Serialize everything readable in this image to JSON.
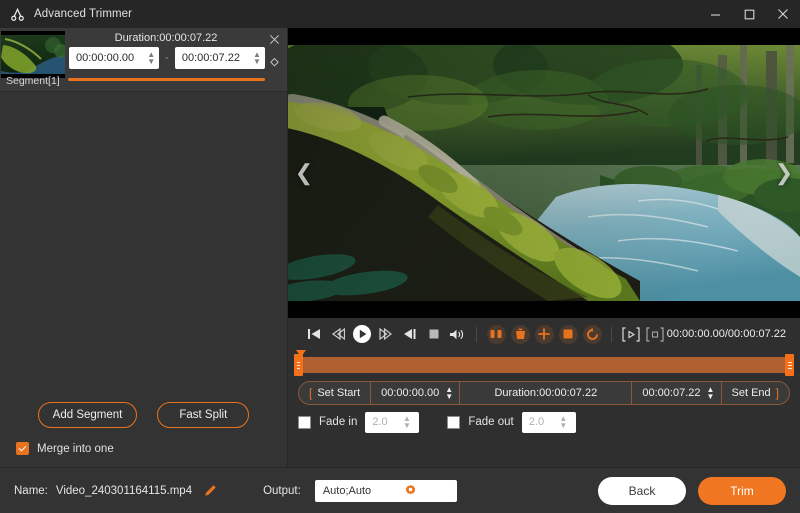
{
  "window": {
    "title": "Advanced Trimmer",
    "logo_icon": "scissors-icon",
    "minimize_icon": "minimize-icon",
    "maximize_icon": "maximize-icon",
    "close_icon": "close-icon"
  },
  "segments_panel": {
    "segments": [
      {
        "duration_label": "Duration:00:00:07.22",
        "start_time": "00:00:00.00",
        "end_time": "00:00:07.22",
        "name": "Segment[1]",
        "separator": "-",
        "close_icon": "close-icon",
        "collapse_icon": "expand-collapse-icon"
      }
    ],
    "add_segment_label": "Add Segment",
    "fast_split_label": "Fast Split",
    "merge_label": "Merge into one",
    "merge_checked": true
  },
  "preview": {
    "prev_icon": "chevron-left-icon",
    "next_icon": "chevron-right-icon",
    "scene_alt": "forest-stream-with-mossy-log"
  },
  "player": {
    "controls": [
      {
        "name": "jump-to-start-button",
        "icon": "skip-to-start-icon"
      },
      {
        "name": "step-backward-button",
        "icon": "rewind-icon"
      },
      {
        "name": "play-button",
        "icon": "play-icon"
      },
      {
        "name": "step-forward-button",
        "icon": "fast-forward-icon"
      },
      {
        "name": "jump-to-end-button",
        "icon": "skip-to-end-icon"
      },
      {
        "name": "stop-button",
        "icon": "stop-icon"
      },
      {
        "name": "volume-button",
        "icon": "volume-icon"
      }
    ],
    "edit_controls": [
      {
        "name": "split-button",
        "icon": "split-icon"
      },
      {
        "name": "delete-button",
        "icon": "trash-icon"
      },
      {
        "name": "add-button",
        "icon": "plus-icon"
      },
      {
        "name": "crop-button",
        "icon": "square-icon"
      },
      {
        "name": "reset-button",
        "icon": "undo-icon"
      }
    ],
    "frame_controls": [
      {
        "name": "set-playback-marker-button",
        "icon": "bracket-play-icon"
      },
      {
        "name": "snapshot-button",
        "icon": "bracket-square-icon"
      }
    ],
    "timecode": "00:00:00.00/00:00:07.22"
  },
  "trim_controls": {
    "set_start_label": "Set Start",
    "set_start_bracket": "[",
    "start_value": "00:00:00.00",
    "duration_label": "Duration:00:00:07.22",
    "end_value": "00:00:07.22",
    "set_end_label": "Set End",
    "set_end_bracket": "]",
    "fade_in_label": "Fade in",
    "fade_in_value": "2.0",
    "fade_in_checked": false,
    "fade_out_label": "Fade out",
    "fade_out_value": "2.0",
    "fade_out_checked": false
  },
  "footer": {
    "name_label": "Name:",
    "file_name": "Video_240301164115.mp4",
    "edit_icon": "pencil-icon",
    "output_label": "Output:",
    "output_value": "Auto;Auto",
    "settings_icon": "gear-icon",
    "back_label": "Back",
    "trim_label": "Trim"
  },
  "colors": {
    "accent": "#e8731e",
    "accent_button": "#f07622",
    "panel_bg": "#333333",
    "app_bg": "#2f2f2f",
    "titlebar_bg": "#262626"
  }
}
